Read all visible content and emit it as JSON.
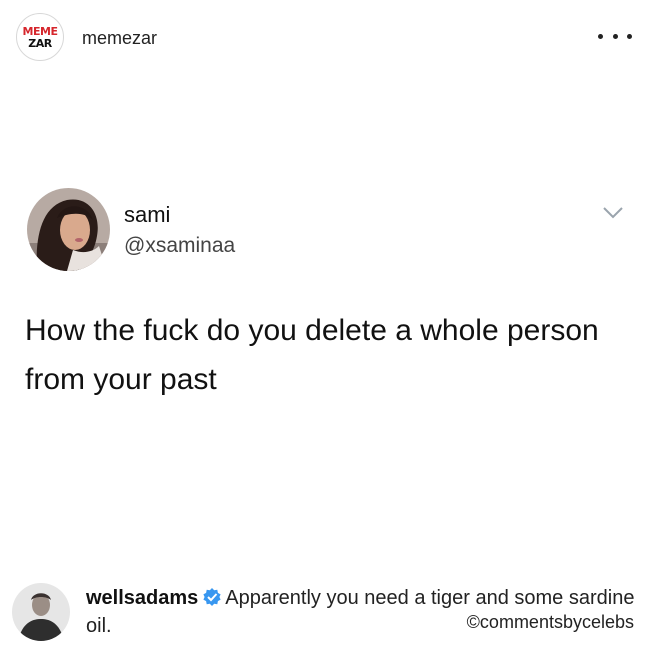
{
  "header": {
    "logo_line1": "MEME",
    "logo_line2": "ZAR",
    "account_name": "memezar",
    "more_icon": "more-horizontal-icon"
  },
  "tweet": {
    "name": "sami",
    "handle": "@xsaminaa",
    "text": "How the fuck do you delete a whole person from your past",
    "menu_icon": "chevron-down-icon"
  },
  "comment": {
    "username": "wellsadams",
    "verified_icon": "verified-badge-icon",
    "text": "Apparently you need a tiger and some sardine oil.",
    "credit": "©commentsbycelebs"
  },
  "colors": {
    "logo_red": "#d6262c",
    "verified_blue": "#3897f0",
    "chevron_gray": "#9aa4ad"
  }
}
